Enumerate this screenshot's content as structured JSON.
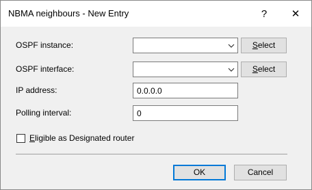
{
  "window": {
    "title": "NBMA neighbours - New Entry",
    "help_label": "?",
    "close_label": "✕"
  },
  "form": {
    "ospf_instance": {
      "label": "OSPF instance:",
      "value": "",
      "select_mnemonic": "S",
      "select_rest": "elect"
    },
    "ospf_interface": {
      "label": "OSPF interface:",
      "value": "",
      "select_mnemonic": "S",
      "select_rest": "elect"
    },
    "ip_address": {
      "label": "IP address:",
      "value": "0.0.0.0"
    },
    "polling_interval": {
      "label": "Polling interval:",
      "value": "0"
    },
    "eligible_dr": {
      "mnemonic": "E",
      "rest": "ligible as Designated router",
      "checked": false
    }
  },
  "buttons": {
    "ok_label": "OK",
    "cancel_label": "Cancel"
  },
  "icons": {
    "dropdown": "chevron-down-icon",
    "help": "help-icon",
    "close": "close-icon"
  }
}
